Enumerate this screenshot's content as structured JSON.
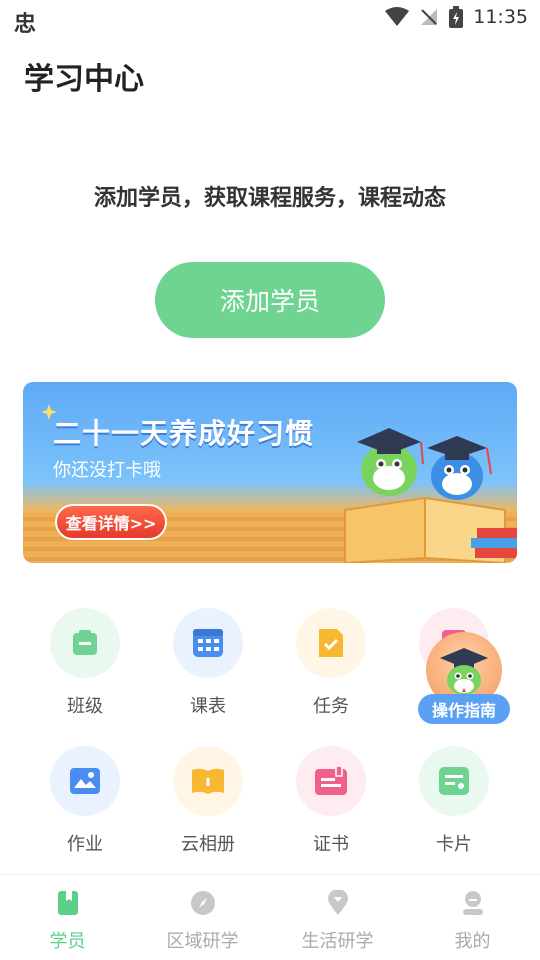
{
  "status": {
    "app_glyph": "忠",
    "time": "11:35"
  },
  "page_title": "学习中心",
  "promo_text": "添加学员，获取课程服务，课程动态",
  "add_button": "添加学员",
  "banner": {
    "title": "二十一天养成好习惯",
    "subtitle": "你还没打卡哦",
    "button": "查看详情>>"
  },
  "grid": [
    {
      "label": "班级",
      "icon": "class-icon",
      "color": "#6fd391",
      "bg": "#eaf9ef"
    },
    {
      "label": "课表",
      "icon": "schedule-icon",
      "color": "#4a8df0",
      "bg": "#e9f2fe"
    },
    {
      "label": "任务",
      "icon": "task-icon",
      "color": "#f7b733",
      "bg": "#fff6e6"
    },
    {
      "label": "作业",
      "icon": "homework-icon",
      "color": "#4a8df0",
      "bg": "#e9f2fe"
    },
    {
      "label": "云相册",
      "icon": "album-icon",
      "color": "#f7b733",
      "bg": "#fff6e6"
    },
    {
      "label": "证书",
      "icon": "certificate-icon",
      "color": "#f0608a",
      "bg": "#feecf1"
    },
    {
      "label": "卡片",
      "icon": "card-icon",
      "color": "#6fd391",
      "bg": "#eaf9ef"
    }
  ],
  "guide_label": "操作指南",
  "nav": [
    {
      "label": "学员",
      "icon": "student-icon",
      "active": true
    },
    {
      "label": "区域研学",
      "icon": "compass-icon",
      "active": false
    },
    {
      "label": "生活研学",
      "icon": "location-icon",
      "active": false
    },
    {
      "label": "我的",
      "icon": "profile-icon",
      "active": false
    }
  ],
  "colors": {
    "accent": "#6fd391",
    "nav_active": "#5ccf88",
    "nav_inactive": "#aaaaaa"
  }
}
